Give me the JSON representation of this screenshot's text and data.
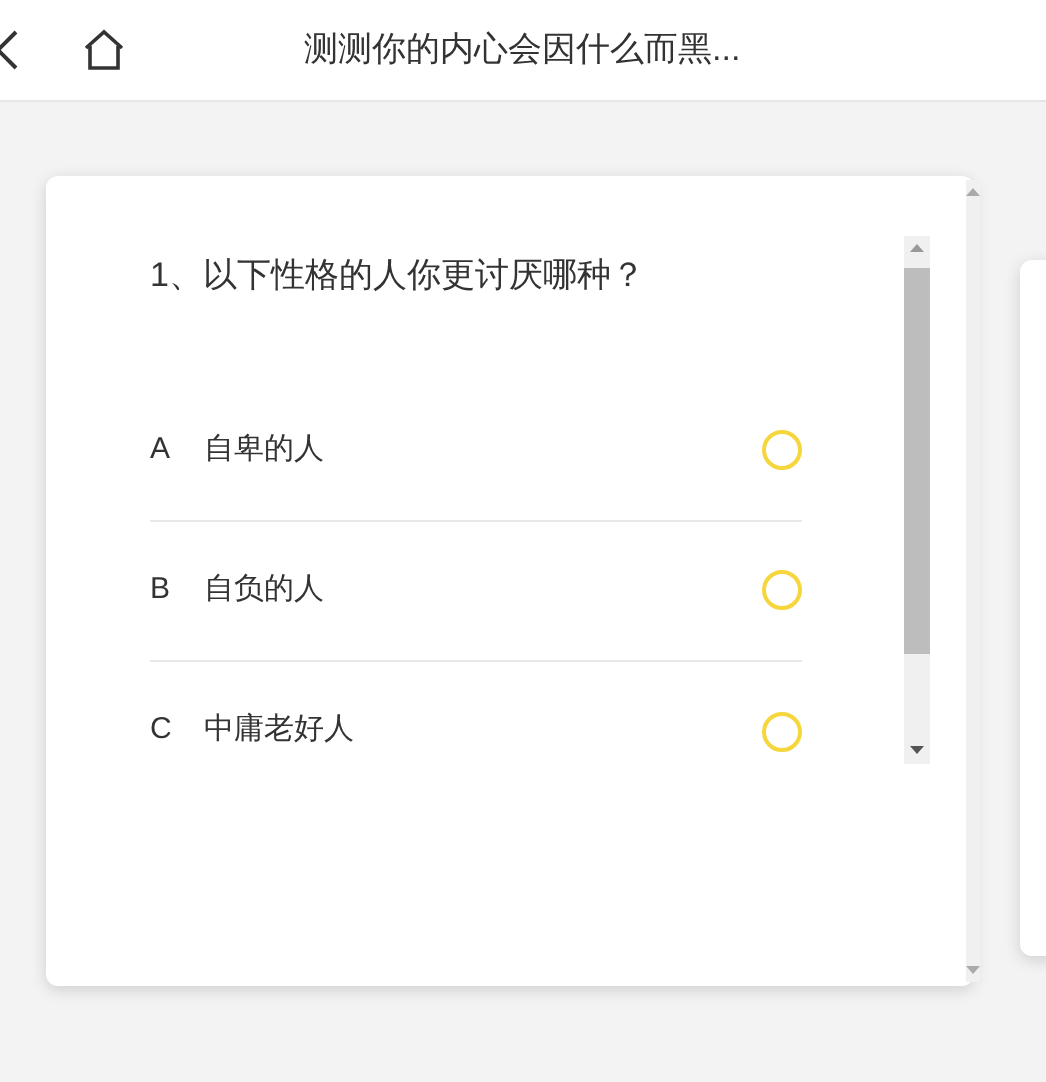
{
  "header": {
    "title": "测测你的内心会因什么而黑..."
  },
  "question": {
    "text": "1、以下性格的人你更讨厌哪种？",
    "options": [
      {
        "letter": "A",
        "label": "自卑的人",
        "selected": false
      },
      {
        "letter": "B",
        "label": "自负的人",
        "selected": false
      },
      {
        "letter": "C",
        "label": "中庸老好人",
        "selected": false
      }
    ]
  }
}
